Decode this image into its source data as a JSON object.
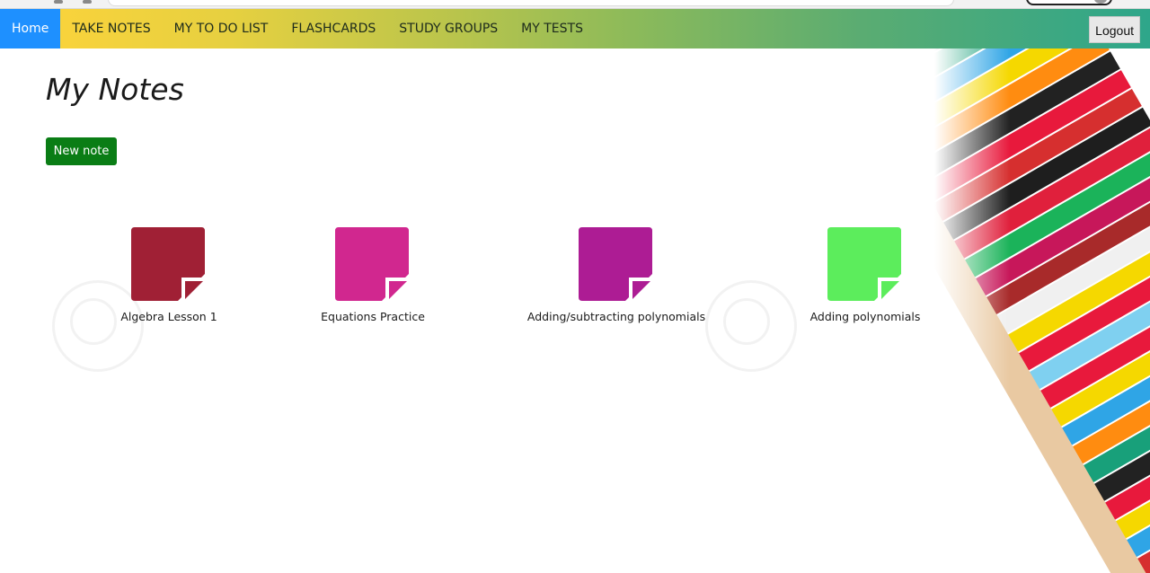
{
  "nav": {
    "home": "Home",
    "items": [
      "TAKE NOTES",
      "MY TO DO LIST",
      "FLASHCARDS",
      "STUDY GROUPS",
      "MY TESTS"
    ],
    "logout": "Logout"
  },
  "page": {
    "title": "My Notes",
    "new_note_label": "New note"
  },
  "notes": [
    {
      "label": "Algebra Lesson 1",
      "color": "#a02035"
    },
    {
      "label": "Equations Practice",
      "color": "#d1278f"
    },
    {
      "label": "Adding/subtracting polynomials",
      "color": "#ad1c94"
    },
    {
      "label": "Adding polynomials",
      "color": "#5ced5c"
    }
  ],
  "colors": {
    "home_active": "#1e90ff",
    "new_note_button": "#0a7d15",
    "nav_gradient_start": "#ffd43a",
    "nav_gradient_end": "#2ea68a"
  },
  "icons": {
    "note": "sticky-note-icon",
    "background": "colored-pencils-image"
  }
}
